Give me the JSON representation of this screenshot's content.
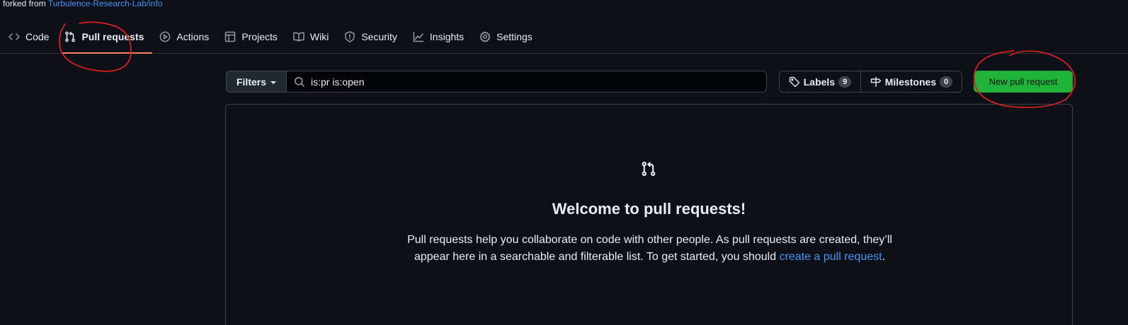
{
  "fork": {
    "prefix": "forked from",
    "source": "Turbulence-Research-Lab/info"
  },
  "nav": {
    "tabs": [
      {
        "label": "Code",
        "icon": "code-icon"
      },
      {
        "label": "Pull requests",
        "icon": "git-pull-request-icon",
        "selected": true
      },
      {
        "label": "Actions",
        "icon": "play-icon"
      },
      {
        "label": "Projects",
        "icon": "table-icon"
      },
      {
        "label": "Wiki",
        "icon": "book-icon"
      },
      {
        "label": "Security",
        "icon": "shield-icon"
      },
      {
        "label": "Insights",
        "icon": "graph-icon"
      },
      {
        "label": "Settings",
        "icon": "gear-icon"
      }
    ]
  },
  "toolbar": {
    "filters_label": "Filters",
    "search_value": "is:pr is:open",
    "labels_label": "Labels",
    "labels_count": "9",
    "milestones_label": "Milestones",
    "milestones_count": "0",
    "new_pr_label": "New pull request"
  },
  "blankslate": {
    "icon": "git-pull-request-icon",
    "title": "Welcome to pull requests!",
    "text_before": "Pull requests help you collaborate on code with other people. As pull requests are created, they’ll appear here in a searchable and filterable list. To get started, you should ",
    "link_text": "create a pull request",
    "text_after": "."
  },
  "colors": {
    "background": "#0d1117",
    "accent_link": "#4493f8",
    "selected_underline": "#f78166",
    "new_pr_button": "#1fb33a",
    "annotation": "#d42020"
  }
}
